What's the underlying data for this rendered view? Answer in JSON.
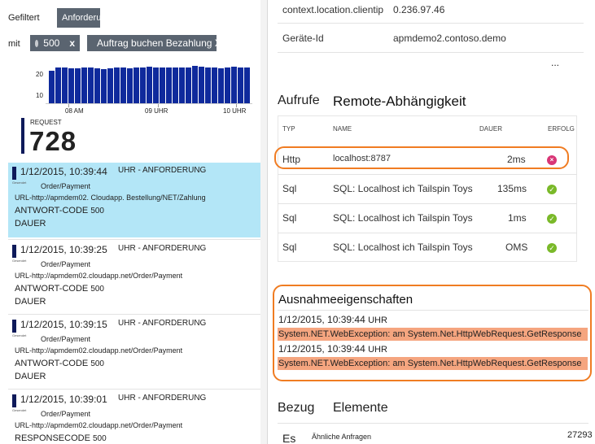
{
  "left": {
    "tab_filtered": "Gefiltert",
    "tab_requests": "Anforderu",
    "filter_with": "mit",
    "chip1": {
      "label": "500",
      "close": "x"
    },
    "chip2": {
      "label": "Auftrag buchen Bezahlung X"
    },
    "chart": {
      "y_ticks": [
        "20",
        "10"
      ],
      "x_ticks": [
        "08 AM",
        "09 UHR",
        "10 UHR"
      ]
    },
    "summary": {
      "label": "REQUEST",
      "count": "728"
    },
    "requests": [
      {
        "time": "1/12/2015, 10:39:44",
        "kind": "UHR - ANFORDERUNG",
        "tiny": "Gesendet",
        "sub": "Order/Payment",
        "url": "URL-http://apmdem02. Cloudapp. Bestellung/NET/Zahlung",
        "code": "ANTWORT-CODE",
        "code_val": "500",
        "dur": "DAUER",
        "selected": true
      },
      {
        "time": "1/12/2015, 10:39:25",
        "kind": "UHR - ANFORDERUNG",
        "tiny": "Gesendet",
        "sub": "Order/Payment",
        "url": "URL-http://apmdem02.cloudapp.net/Order/Payment",
        "code": "ANTWORT-CODE",
        "code_val": "500",
        "dur": "DAUER",
        "selected": false
      },
      {
        "time": "1/12/2015, 10:39:15",
        "kind": "UHR - ANFORDERUNG",
        "tiny": "Gesendet",
        "sub": "Order/Payment",
        "url": "URL-http://apmdem02.cloudapp.net/Order/Payment",
        "code": "ANTWORT-CODE",
        "code_val": "500",
        "dur": "DAUER",
        "selected": false
      },
      {
        "time": "1/12/2015, 10:39:01",
        "kind": "UHR - ANFORDERUNG",
        "tiny": "Gesendet",
        "sub": "Order/Payment",
        "url": "URL-http://apmdem02.cloudapp.net/Order/Payment",
        "code": "RESPONSECODE",
        "code_val": "500",
        "dur": "",
        "selected": false
      }
    ]
  },
  "right": {
    "prop1": {
      "key": "context.location.clientip",
      "value": "0.236.97.46"
    },
    "prop2": {
      "key": "Geräte-Id",
      "value": "apmdemo2.contoso.demo"
    },
    "more": "...",
    "calls_title": "Aufrufe",
    "remote_title": "Remote-Abhängigkeit",
    "table_headers": {
      "type": "TYP",
      "name": "NAME",
      "duration": "DAUER",
      "success": "ERFOLG"
    },
    "rows": [
      {
        "type": "Http",
        "name": "localhost:8787",
        "duration": "2ms",
        "status": "error"
      },
      {
        "type": "Sql",
        "name": "SQL: Localhost ich Tailspin Toys",
        "duration": "135ms",
        "status": "ok"
      },
      {
        "type": "Sql",
        "name": "SQL: Localhost ich Tailspin Toys",
        "duration": "1ms",
        "status": "ok"
      },
      {
        "type": "Sql",
        "name": "SQL: Localhost ich Tailspin Toys",
        "duration": "OMS",
        "status": "ok"
      }
    ],
    "exceptions_title": "Ausnahmeeigenschaften",
    "exceptions": [
      {
        "time": "1/12/2015, 10:39:44",
        "unit": "UHR",
        "text": "System.NET.WebException: am System.Net.HttpWebRequest.GetResponse"
      },
      {
        "time": "1/12/2015, 10:39:44",
        "unit": "UHR",
        "text": "System.NET.WebException: am System.Net.HttpWebRequest.GetResponse"
      }
    ],
    "related_title": "Bezug",
    "elements_title": "Elemente",
    "related_row": {
      "prefix": "Es",
      "label": "Ähnliche Anfragen",
      "count": "27293"
    }
  },
  "colors": {
    "accent": "#0f2a9c",
    "selected_bg": "#b3e6f7",
    "highlight_border": "#f07c22",
    "exception_bg": "#f5a57f",
    "ok": "#7ab929",
    "error": "#d93676"
  }
}
